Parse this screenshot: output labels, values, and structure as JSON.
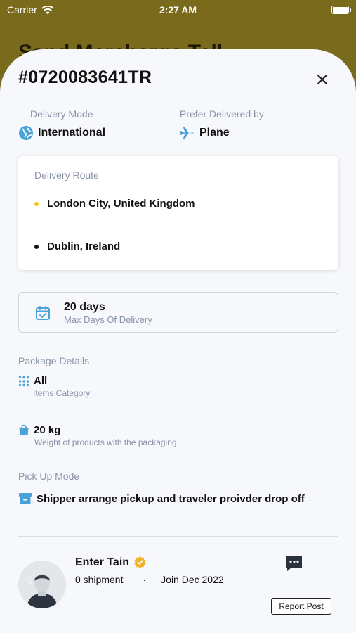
{
  "status_bar": {
    "carrier": "Carrier",
    "time": "2:27 AM"
  },
  "background_title": "Send Mercharge Tell",
  "order": {
    "id": "#0720083641TR"
  },
  "delivery_mode": {
    "label": "Delivery Mode",
    "value": "International",
    "icon": "globe-icon"
  },
  "prefer_delivered": {
    "label": "Prefer Delivered by",
    "value": "Plane",
    "icon": "plane-icon"
  },
  "route": {
    "title": "Delivery Route",
    "origin": "London City, United Kingdom",
    "destination": "Dublin, Ireland"
  },
  "max_days": {
    "value": "20 days",
    "label": "Max Days Of Delivery"
  },
  "package": {
    "title": "Package Details",
    "category_value": "All",
    "category_label": "Items Category",
    "weight_value": "20 kg",
    "weight_label": "Weight of products with the packaging"
  },
  "pickup": {
    "title": "Pick Up Mode",
    "value": "Shipper arrange pickup and traveler proivder drop off"
  },
  "user": {
    "name": "Enter Tain",
    "shipments": "0 shipment",
    "separator": "·",
    "joined": "Join Dec 2022",
    "report_label": "Report Post"
  },
  "colors": {
    "accent_blue": "#4aa3d8",
    "origin_dot": "#f2c318",
    "verified_badge": "#f0b429",
    "backdrop": "#7a6a1c"
  }
}
